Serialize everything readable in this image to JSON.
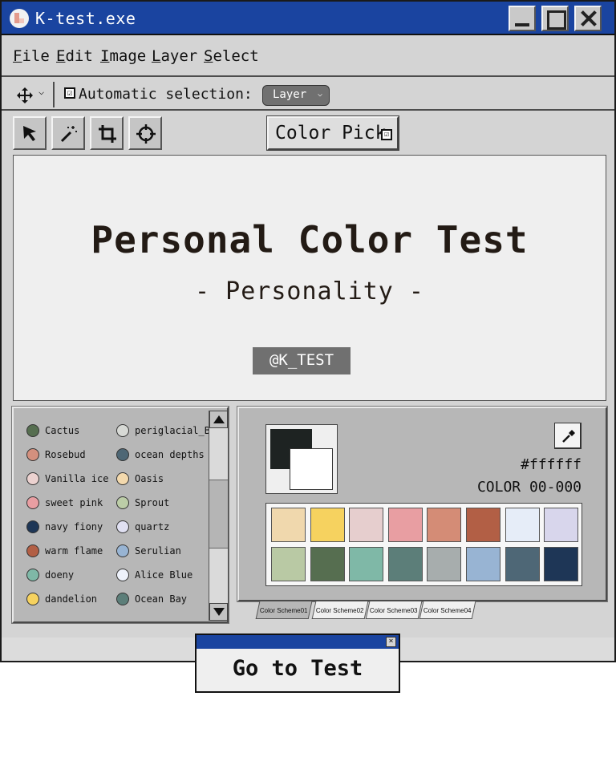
{
  "window": {
    "title": "K-test.exe"
  },
  "menu": [
    "File",
    "Edit",
    "Image",
    "Layer",
    "Select"
  ],
  "toolbar": {
    "auto_select_label": "Automatic selection:",
    "auto_select_checked": "☑",
    "layer_value": "Layer"
  },
  "tools": {
    "color_pick_label": "Color Pick",
    "color_pick_check": "☑"
  },
  "canvas": {
    "title": "Personal Color Test",
    "subtitle": "- Personality -",
    "handle": "@K_TEST"
  },
  "colors_list": [
    {
      "name": "Cactus",
      "color": "#566e50"
    },
    {
      "name": "periglacial_B",
      "color": "#d7d9d5"
    },
    {
      "name": "Rosebud",
      "color": "#d3907e"
    },
    {
      "name": "ocean depths",
      "color": "#4e6775"
    },
    {
      "name": "Vanilla ice",
      "color": "#ecd2d0"
    },
    {
      "name": "Oasis",
      "color": "#f3d9ad"
    },
    {
      "name": "sweet pink",
      "color": "#e89ea2"
    },
    {
      "name": "Sprout",
      "color": "#bccda7"
    },
    {
      "name": "navy fiony",
      "color": "#1e3656"
    },
    {
      "name": "quartz",
      "color": "#e0e0f2"
    },
    {
      "name": "warm flame",
      "color": "#b25f45"
    },
    {
      "name": "Serulian",
      "color": "#98b4d3"
    },
    {
      "name": "doeny",
      "color": "#7fb8a7"
    },
    {
      "name": "Alice Blue",
      "color": "#eef2fb"
    },
    {
      "name": "dandelion",
      "color": "#f6d25f"
    },
    {
      "name": "Ocean Bay",
      "color": "#5c7e79"
    }
  ],
  "palette": {
    "foreground": "#1e2322",
    "background": "#ffffff",
    "hex": "#ffffff",
    "code": "COLOR 00-000",
    "swatches": [
      "#f0d8ad",
      "#f6d25f",
      "#e6cece",
      "#e89ea2",
      "#d48c76",
      "#b25f45",
      "#e6edf8",
      "#d8d6ec",
      "#b9c9a4",
      "#566e50",
      "#7fb8a7",
      "#5c7e79",
      "#a7adad",
      "#98b4d3",
      "#4e6776",
      "#1e3656"
    ]
  },
  "tabs": [
    "Color Scheme01",
    "Color Scheme02",
    "Color Scheme03",
    "Color Scheme04"
  ],
  "popup": {
    "label": "Go to Test",
    "close": "×"
  }
}
